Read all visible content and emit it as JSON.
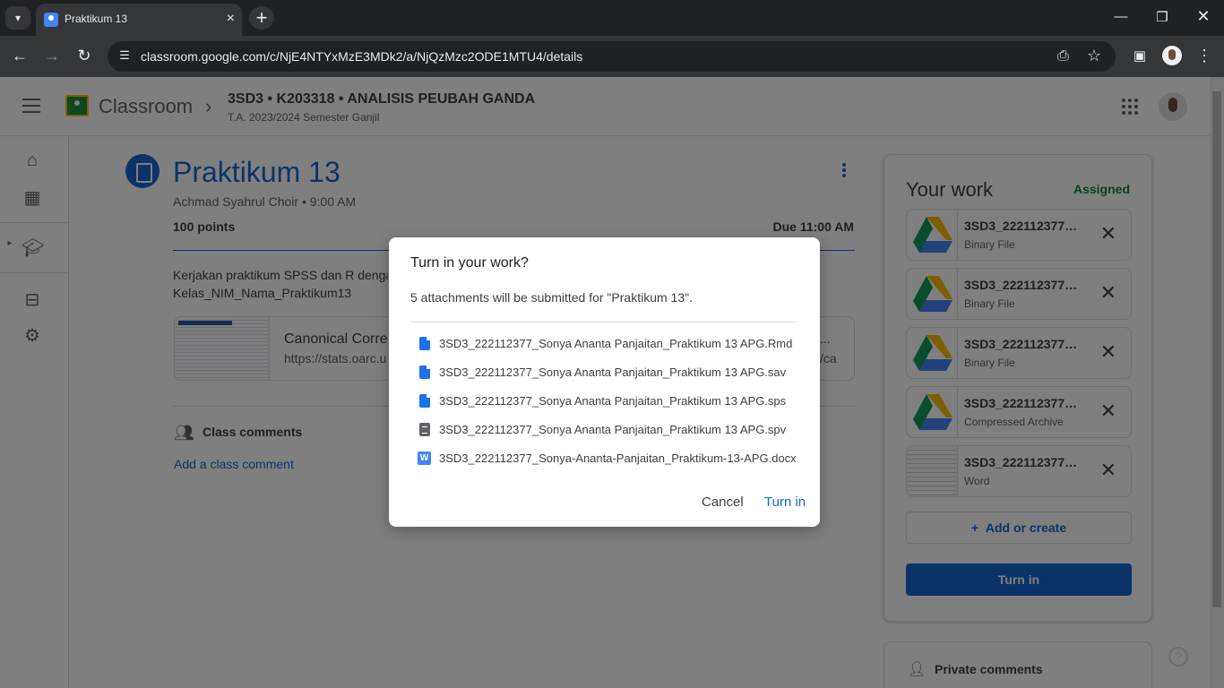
{
  "browser": {
    "tab_title": "Praktikum 13",
    "url": "classroom.google.com/c/NjE4NTYxMzE3MDk2/a/NjQzMzc2ODE1MTU4/details"
  },
  "header": {
    "app_name": "Classroom",
    "course_name": "3SD3 • K203318 • ANALISIS PEUBAH GANDA",
    "course_section": "T.A. 2023/2024 Semester Ganjil"
  },
  "assignment": {
    "title": "Praktikum 13",
    "meta": "Achmad Syahrul Choir • 9:00 AM",
    "points": "100 points",
    "due": "Due 11:00 AM",
    "description_line1": "Kerjakan praktikum SPSS dan R denga",
    "description_line2": "Kelas_NIM_Nama_Praktikum13",
    "link_title": "Canonical Corre",
    "link_url": "https://stats.oarc.u",
    "link_right_title": "...",
    "link_right_url": "/ca"
  },
  "comments": {
    "label": "Class comments",
    "add": "Add a class comment"
  },
  "work": {
    "title": "Your work",
    "status": "Assigned",
    "attachments": [
      {
        "name": "3SD3_222112377_Sonya Ananta Panjaitan_Praktikum 13 APG.Rmd",
        "type": "Binary File"
      },
      {
        "name": "3SD3_222112377_Sonya Ananta Panjaitan_Praktikum 13 APG.sav",
        "type": "Binary File"
      },
      {
        "name": "3SD3_222112377_Sonya Ananta Panjaitan_Praktikum 13 APG.sps",
        "type": "Binary File"
      },
      {
        "name": "3SD3_222112377_Sonya Ananta Panjaitan_Praktikum 13 APG.spv",
        "type": "Compressed Archive"
      },
      {
        "name": "3SD3_222112377_Sonya-Ananta-Panjaitan_Praktikum-13-APG.docx",
        "type": "Word"
      }
    ],
    "add_create": "Add or create",
    "turn_in": "Turn in",
    "private_comments": "Private comments"
  },
  "dialog": {
    "title": "Turn in your work?",
    "subtitle": "5 attachments will be submitted for \"Praktikum 13\".",
    "files": [
      "3SD3_222112377_Sonya Ananta Panjaitan_Praktikum 13 APG.Rmd",
      "3SD3_222112377_Sonya Ananta Panjaitan_Praktikum 13 APG.sav",
      "3SD3_222112377_Sonya Ananta Panjaitan_Praktikum 13 APG.sps",
      "3SD3_222112377_Sonya Ananta Panjaitan_Praktikum 13 APG.spv",
      "3SD3_222112377_Sonya-Ananta-Panjaitan_Praktikum-13-APG.docx"
    ],
    "file_icons": [
      "doc-icon",
      "doc-icon",
      "doc-icon",
      "archive-icon",
      "word-icon"
    ],
    "word_glyph": "W",
    "cancel": "Cancel",
    "turn_in": "Turn in"
  },
  "colors": {
    "accent": "#1967d2",
    "assigned": "#188038"
  }
}
